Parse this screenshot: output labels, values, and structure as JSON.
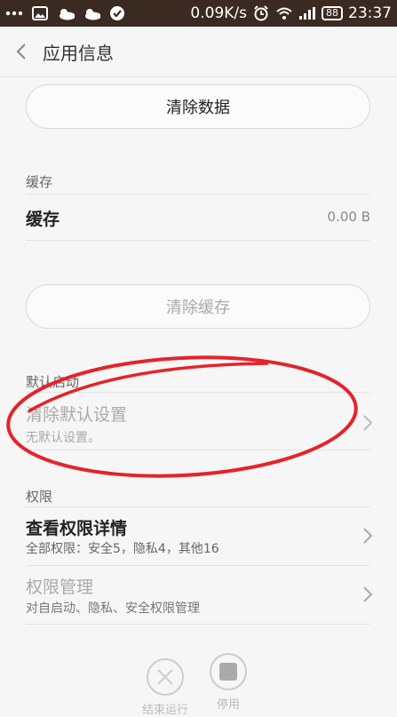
{
  "status_bar": {
    "speed": "0.09K/s",
    "battery": "88",
    "time": "23:37"
  },
  "header": {
    "title": "应用信息"
  },
  "data_section": {
    "clear_data_label": "清除数据"
  },
  "cache_section": {
    "section_label": "缓存",
    "row_title": "缓存",
    "row_value": "0.00 B",
    "clear_cache_label": "清除缓存"
  },
  "default_launch": {
    "section_label": "默认启动",
    "row_title": "清除默认设置",
    "row_sub": "无默认设置。"
  },
  "permissions": {
    "section_label": "权限",
    "details_title": "查看权限详情",
    "details_sub": "全部权限：安全5，隐私4，其他16",
    "manage_title": "权限管理",
    "manage_sub": "对自启动、隐私、安全权限管理"
  },
  "bottom_bar": {
    "end_label": "结束运行",
    "disable_label": "停用"
  },
  "colors": {
    "status_bg": "#3b2a22",
    "annotation_red": "#e5232a",
    "disabled_text": "#aaaaaa"
  }
}
